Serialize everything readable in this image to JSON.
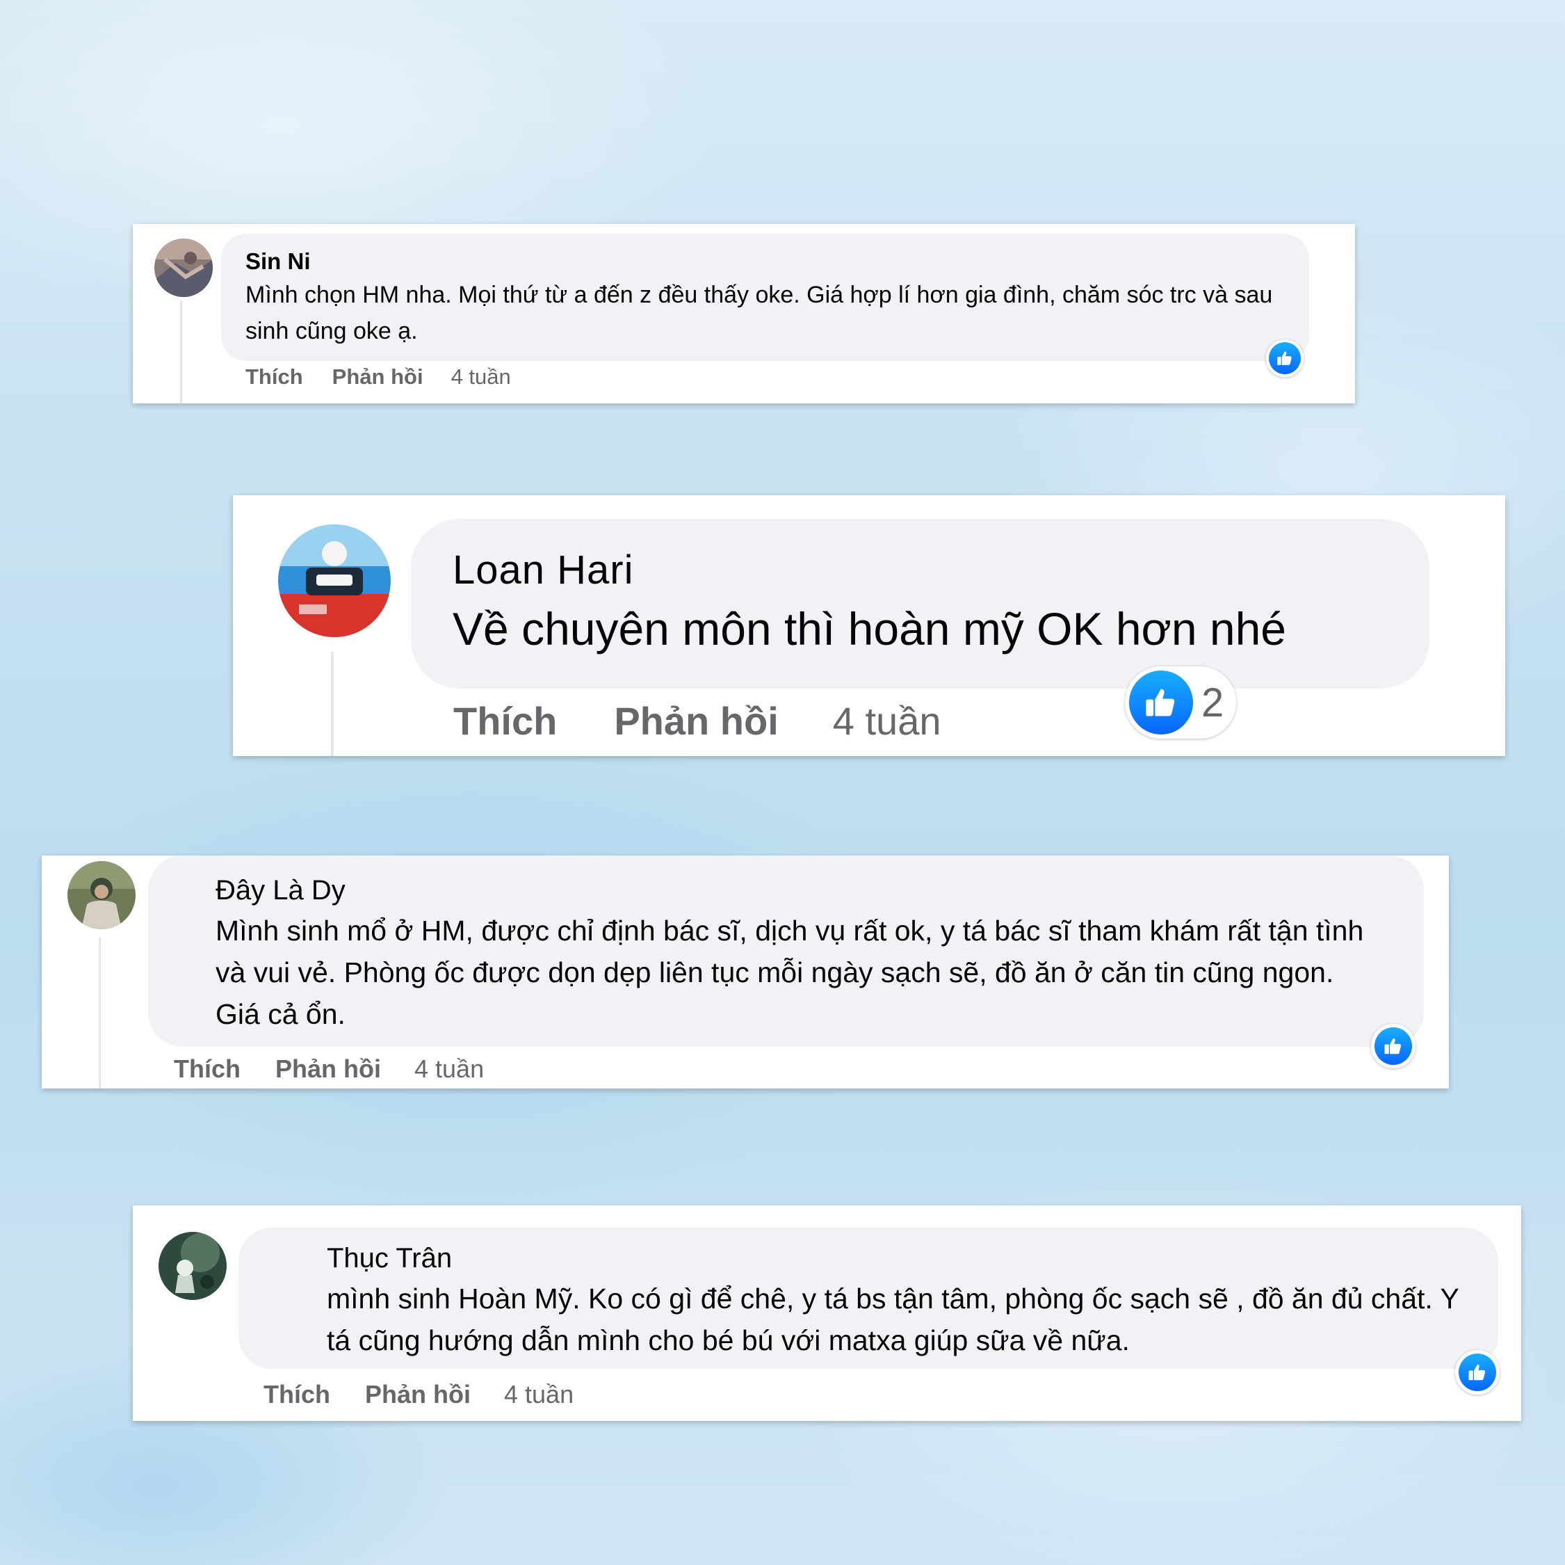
{
  "comments": [
    {
      "author": "Sin Ni",
      "text": "Mình chọn HM nha. Mọi thứ từ a đến z đều thấy oke. Giá hợp lí hơn gia đình, chăm sóc trc và sau sinh cũng oke ạ.",
      "actions": {
        "like": "Thích",
        "reply": "Phản hồi",
        "time": "4 tuần"
      },
      "reaction_count": "",
      "avatar_colors": [
        "#8a7a78",
        "#5a5b6d",
        "#c9b4a8"
      ]
    },
    {
      "author": "Loan Hari",
      "text": "Về chuyên môn thì hoàn mỹ OK hơn nhé",
      "actions": {
        "like": "Thích",
        "reply": "Phản hồi",
        "time": "4 tuần"
      },
      "reaction_count": "2",
      "avatar_colors": [
        "#2f8fd8",
        "#d8342b",
        "#f4f4f4"
      ]
    },
    {
      "author": "Đây Là Dy",
      "text": "Mình sinh mổ ở HM, được chỉ định bác sĩ, dịch vụ rất ok, y tá bác sĩ tham khám rất tận tình và vui vẻ. Phòng ốc được dọn dẹp liên tục mỗi ngày sạch sẽ, đồ ăn ở căn tin cũng ngon. Giá cả ổn.",
      "actions": {
        "like": "Thích",
        "reply": "Phản hồi",
        "time": "4 tuần"
      },
      "reaction_count": "",
      "avatar_colors": [
        "#6f7a56",
        "#3d4a3a",
        "#d5d0c2"
      ]
    },
    {
      "author": "Thục Trân",
      "text": "mình sinh Hoàn Mỹ. Ko có gì để chê, y tá bs tận tâm, phòng ốc sạch sẽ , đồ ăn đủ chất. Y tá cũng hướng dẫn mình cho bé bú với matxa giúp sữa về nữa.",
      "actions": {
        "like": "Thích",
        "reply": "Phản hồi",
        "time": "4 tuần"
      },
      "reaction_count": "",
      "avatar_colors": [
        "#2d4a3c",
        "#5f7d6a",
        "#e8efe6"
      ]
    }
  ],
  "colors": {
    "like_blue": "#0866ff",
    "bubble_gray": "#f0f2f5",
    "meta_gray": "#65676b",
    "text_dark": "#050505"
  },
  "icons": {
    "reaction": "thumbs-up-icon"
  }
}
